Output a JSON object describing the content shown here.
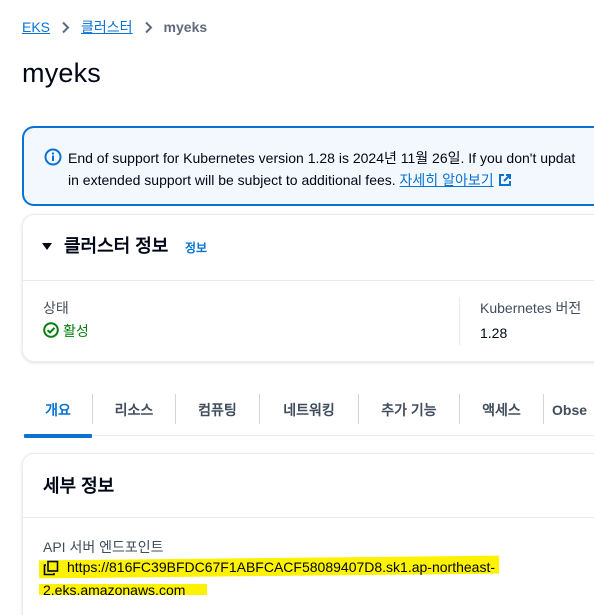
{
  "breadcrumb": {
    "items": [
      "EKS",
      "클러스터"
    ],
    "current": "myeks"
  },
  "page": {
    "title": "myeks"
  },
  "alert": {
    "line1": "End of support for Kubernetes version 1.28 is 2024년 11월 26일. If you don't updat",
    "line2": "in extended support will be subject to additional fees.",
    "link": "자세히 알아보기"
  },
  "cluster_info": {
    "title": "클러스터 정보",
    "info_link": "정보",
    "status_label": "상태",
    "status_value": "활성",
    "version_label": "Kubernetes 버전",
    "version_value": "1.28"
  },
  "tabs": [
    "개요",
    "리소스",
    "컴퓨팅",
    "네트워킹",
    "추가 기능",
    "액세스",
    "Obse"
  ],
  "details": {
    "title": "세부 정보",
    "api_label": "API 서버 엔드포인트",
    "endpoint_line1": "https://816FC39BFDC67F1ABFCACF58089407D8.sk1.ap-northeast-",
    "endpoint_line2": "2.eks.amazonaws.com"
  },
  "colors": {
    "accent": "#0972d3",
    "success": "#037f0c",
    "highlight": "#fff200"
  }
}
